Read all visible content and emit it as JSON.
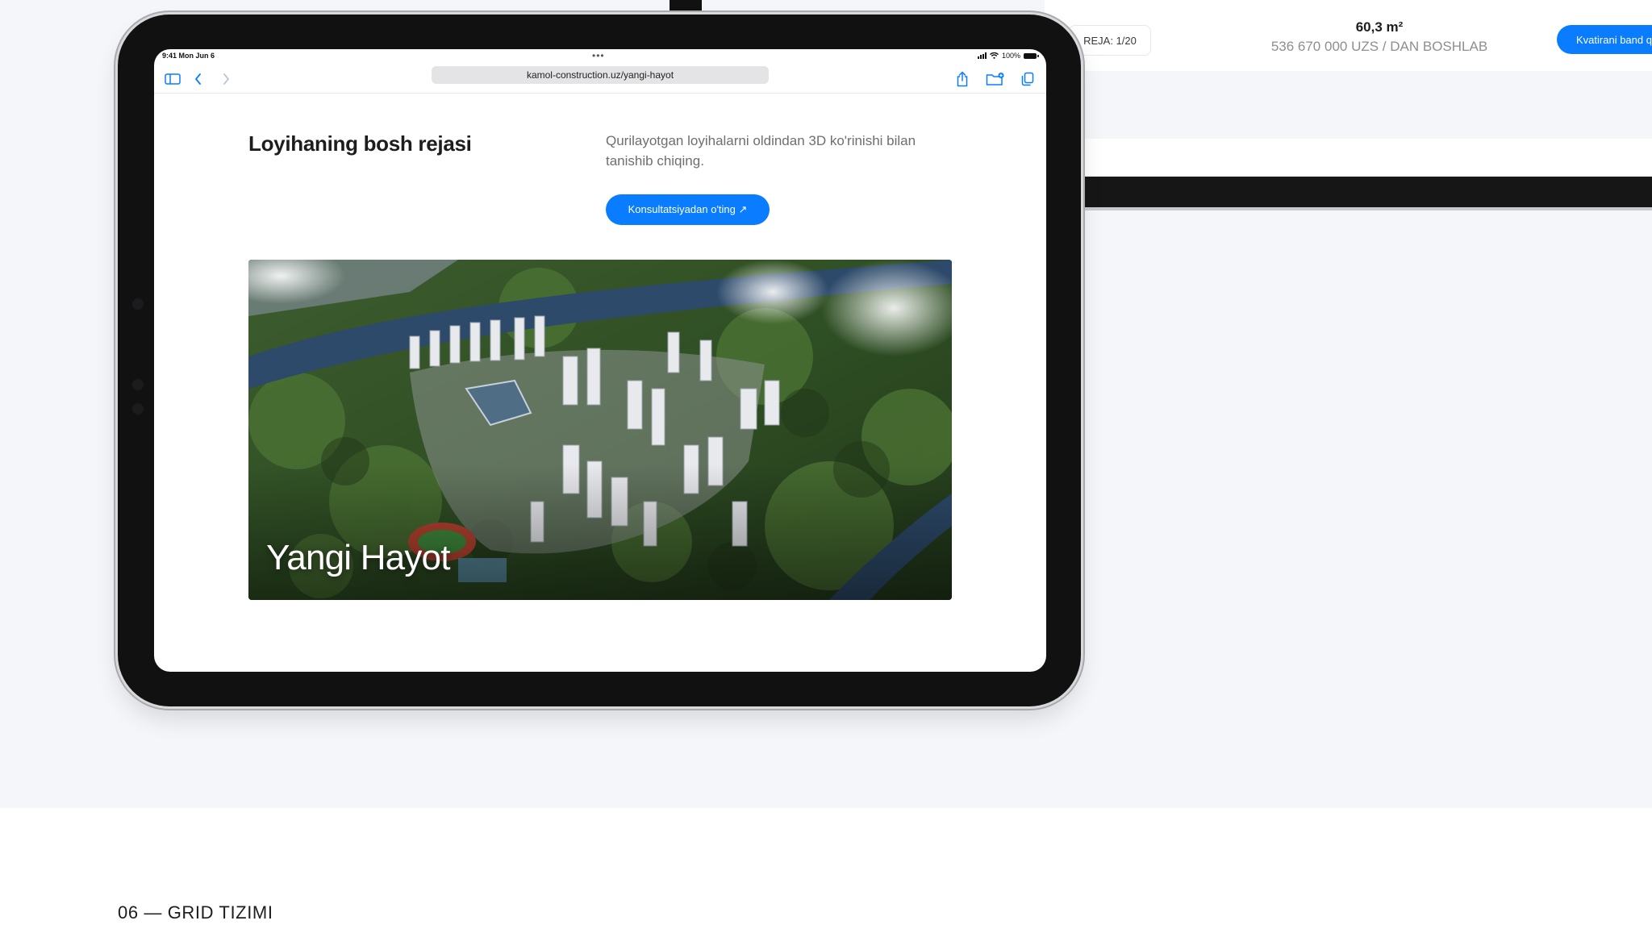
{
  "background_panel": {
    "plan_badge": "REJA: 1/20",
    "area": "60,3 m²",
    "price": "536 670 000 UZS / DAN BOSHLAB",
    "cta_label": "Kvatirani band q"
  },
  "statusbar": {
    "time": "9:41  Mon Jun 6",
    "more": "•••",
    "battery": "100%"
  },
  "browser": {
    "url": "kamol-construction.uz/yangi-hayot",
    "icons": [
      "sidebar-icon",
      "back-icon",
      "forward-icon",
      "share-icon",
      "add-tab-icon",
      "tabs-icon"
    ]
  },
  "page": {
    "title": "Loyihaning bosh rejasi",
    "description": "Qurilayotgan loyihalarni oldindan 3D ko'rinishi bilan tanishib chiqing.",
    "cta_label": "Konsultatsiyadan o'ting ↗",
    "hero_title": "Yangi Hayot"
  },
  "footer": {
    "section_label": "06 — GRID TIZIMI"
  },
  "colors": {
    "accent": "#0a7cff",
    "stage_bg": "#f5f6f9",
    "device_frame": "#111112"
  }
}
